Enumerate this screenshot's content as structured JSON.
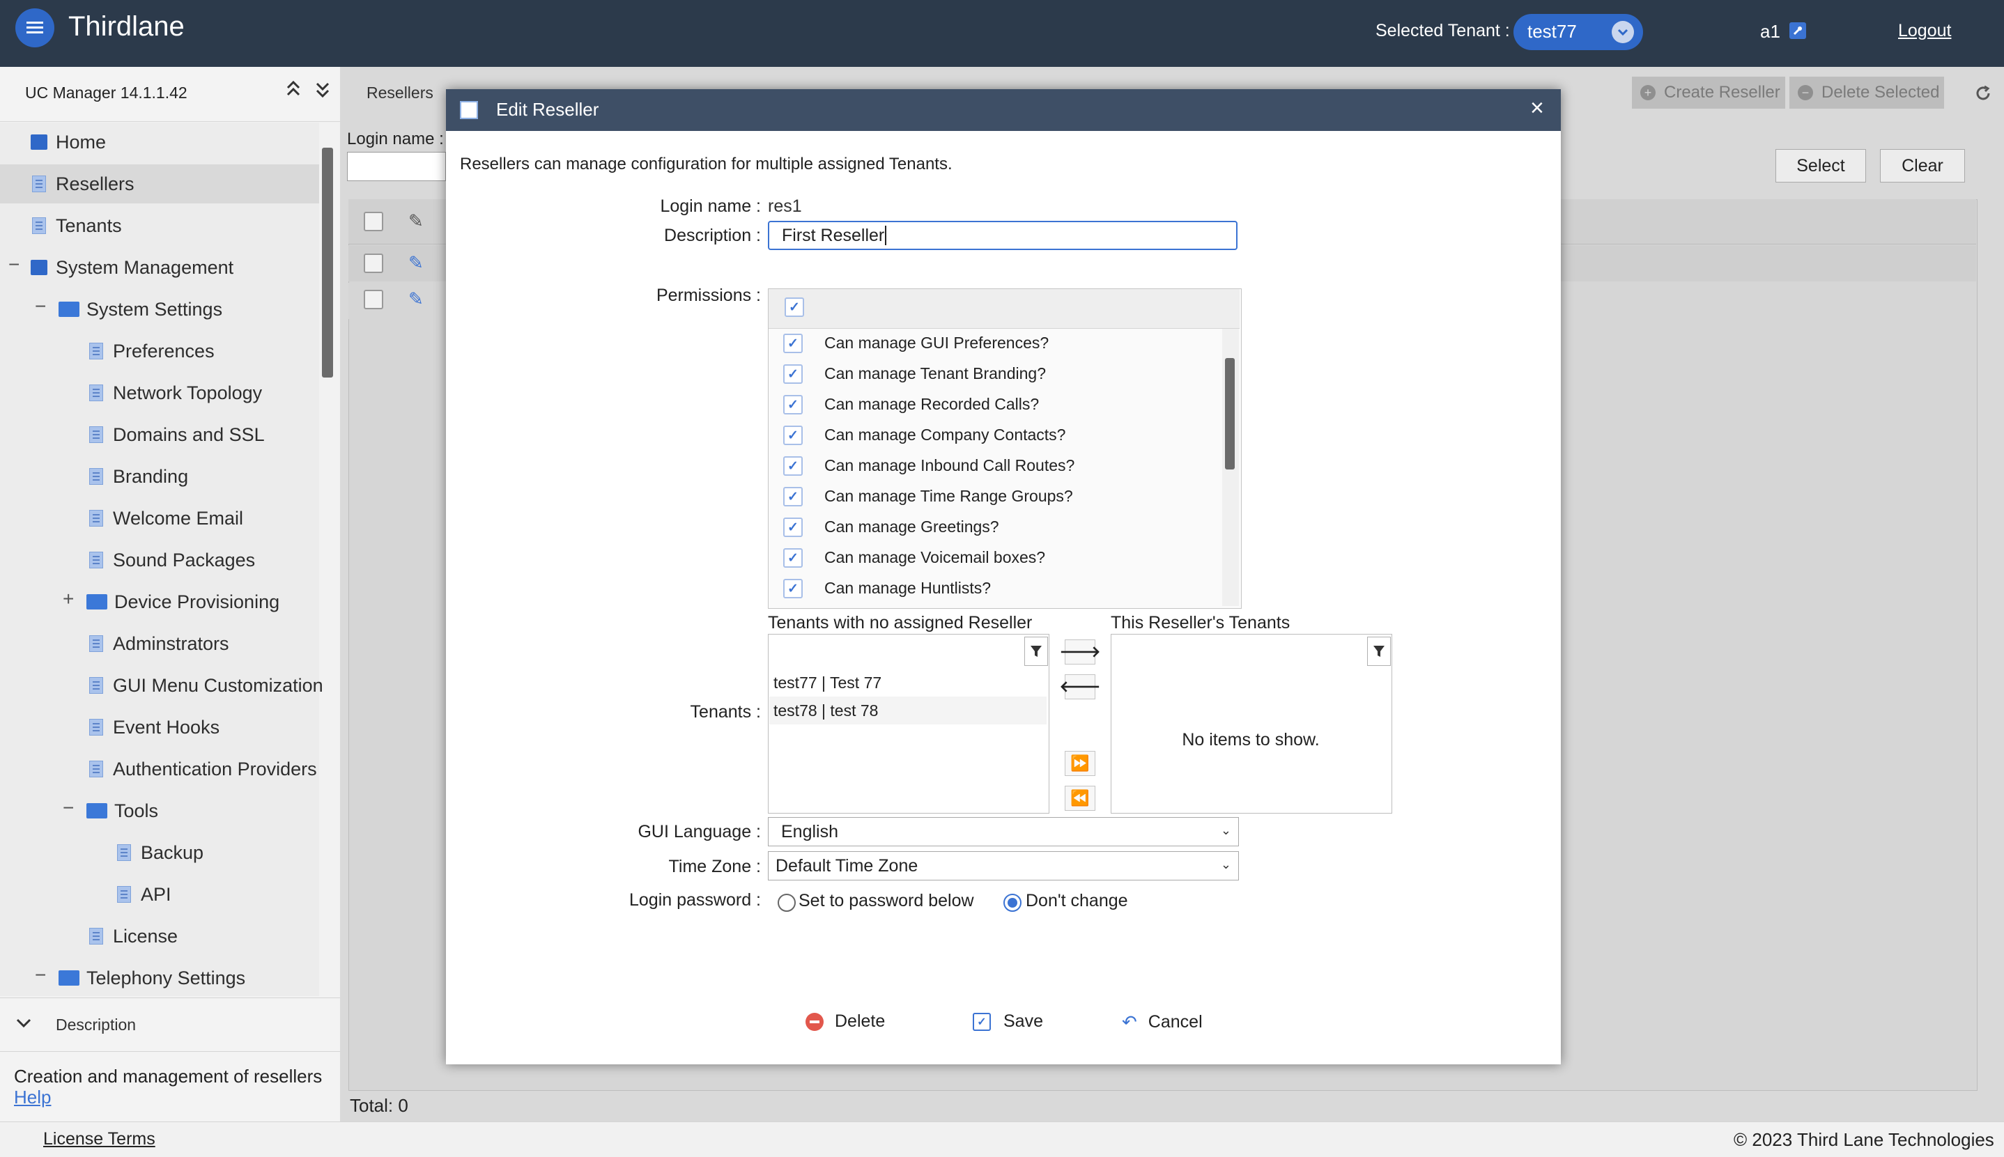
{
  "header": {
    "app_title": "Thirdlane",
    "selected_tenant_label": "Selected Tenant :",
    "selected_tenant": "test77",
    "user": "a1",
    "logout": "Logout"
  },
  "sidebar": {
    "version": "UC Manager 14.1.1.42",
    "items": [
      {
        "label": "Home"
      },
      {
        "label": "Resellers"
      },
      {
        "label": "Tenants"
      },
      {
        "label": "System Management"
      },
      {
        "label": "System Settings"
      },
      {
        "label": "Preferences"
      },
      {
        "label": "Network Topology"
      },
      {
        "label": "Domains and SSL"
      },
      {
        "label": "Branding"
      },
      {
        "label": "Welcome Email"
      },
      {
        "label": "Sound Packages"
      },
      {
        "label": "Device Provisioning"
      },
      {
        "label": "Adminstrators"
      },
      {
        "label": "GUI Menu Customization"
      },
      {
        "label": "Event Hooks"
      },
      {
        "label": "Authentication Providers"
      },
      {
        "label": "Tools"
      },
      {
        "label": "Backup"
      },
      {
        "label": "API"
      },
      {
        "label": "License"
      },
      {
        "label": "Telephony Settings"
      }
    ],
    "description_title": "Description",
    "description_text": "Creation and management of resellers",
    "help_link": "Help"
  },
  "main": {
    "breadcrumb": "Resellers",
    "login_filter_label": "Login name :",
    "create_button": "Create Reseller",
    "delete_selected_button": "Delete Selected",
    "select_button": "Select",
    "clear_button": "Clear",
    "total": "Total: 0"
  },
  "dialog": {
    "title": "Edit Reseller",
    "intro": "Resellers can manage configuration for multiple assigned Tenants.",
    "login_name_label": "Login name :",
    "login_name_value": "res1",
    "description_label": "Description :",
    "description_value": "First Reseller",
    "permissions_label": "Permissions :",
    "permissions": [
      "Can manage GUI Preferences?",
      "Can manage Tenant Branding?",
      "Can manage Recorded Calls?",
      "Can manage Company Contacts?",
      "Can manage Inbound Call Routes?",
      "Can manage Time Range Groups?",
      "Can manage Greetings?",
      "Can manage Voicemail boxes?",
      "Can manage Huntlists?"
    ],
    "tenants_label": "Tenants :",
    "available_title": "Tenants with no assigned Reseller",
    "assigned_title": "This Reseller's Tenants",
    "available_tenants": [
      "test77 | Test 77",
      "test78 | test 78"
    ],
    "no_items": "No items to show.",
    "gui_language_label": "GUI Language :",
    "gui_language": "English",
    "time_zone_label": "Time Zone :",
    "time_zone": "Default Time Zone",
    "login_password_label": "Login password :",
    "pwd_option_set": "Set to password below",
    "pwd_option_keep": "Don't change",
    "delete": "Delete",
    "save": "Save",
    "cancel": "Cancel"
  },
  "footer": {
    "license_terms": "License Terms",
    "copyright": "© 2023 Third Lane Technologies"
  },
  "colors": {
    "topbar": "#2c3a4b",
    "accent": "#3b73d3",
    "dialog_titlebar": "#3e4f66",
    "danger": "#e2574c"
  }
}
